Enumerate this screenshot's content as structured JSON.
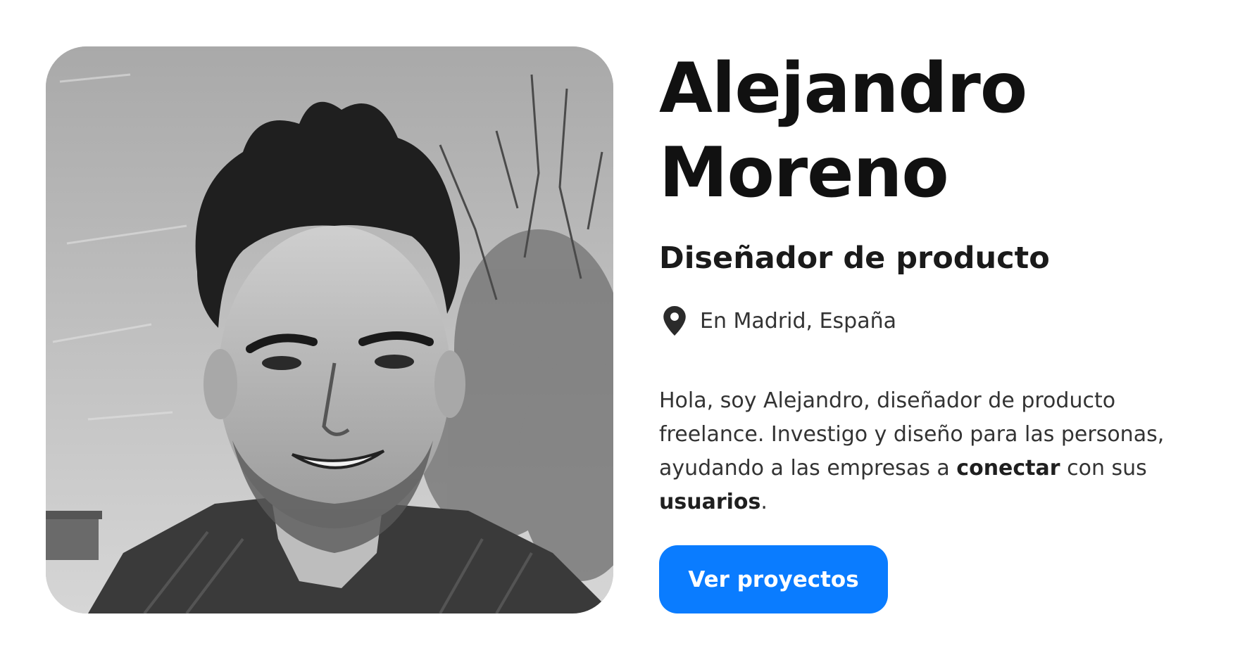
{
  "profile": {
    "name_line1": "Alejandro",
    "name_line2": "Moreno",
    "role": "Diseñador de producto",
    "location": "En Madrid, España",
    "photo_icon": "portrait-photo"
  },
  "bio": {
    "part1": "Hola, soy Alejandro, diseñador de producto freelance. Investigo y diseño para las personas, ayudando a las empresas a ",
    "bold1": "conectar",
    "part2": " con sus ",
    "bold2": "usuarios",
    "part3": "."
  },
  "cta": {
    "label": "Ver proyectos",
    "color": "#0a7cff"
  },
  "icons": {
    "location": "map-pin-icon"
  }
}
